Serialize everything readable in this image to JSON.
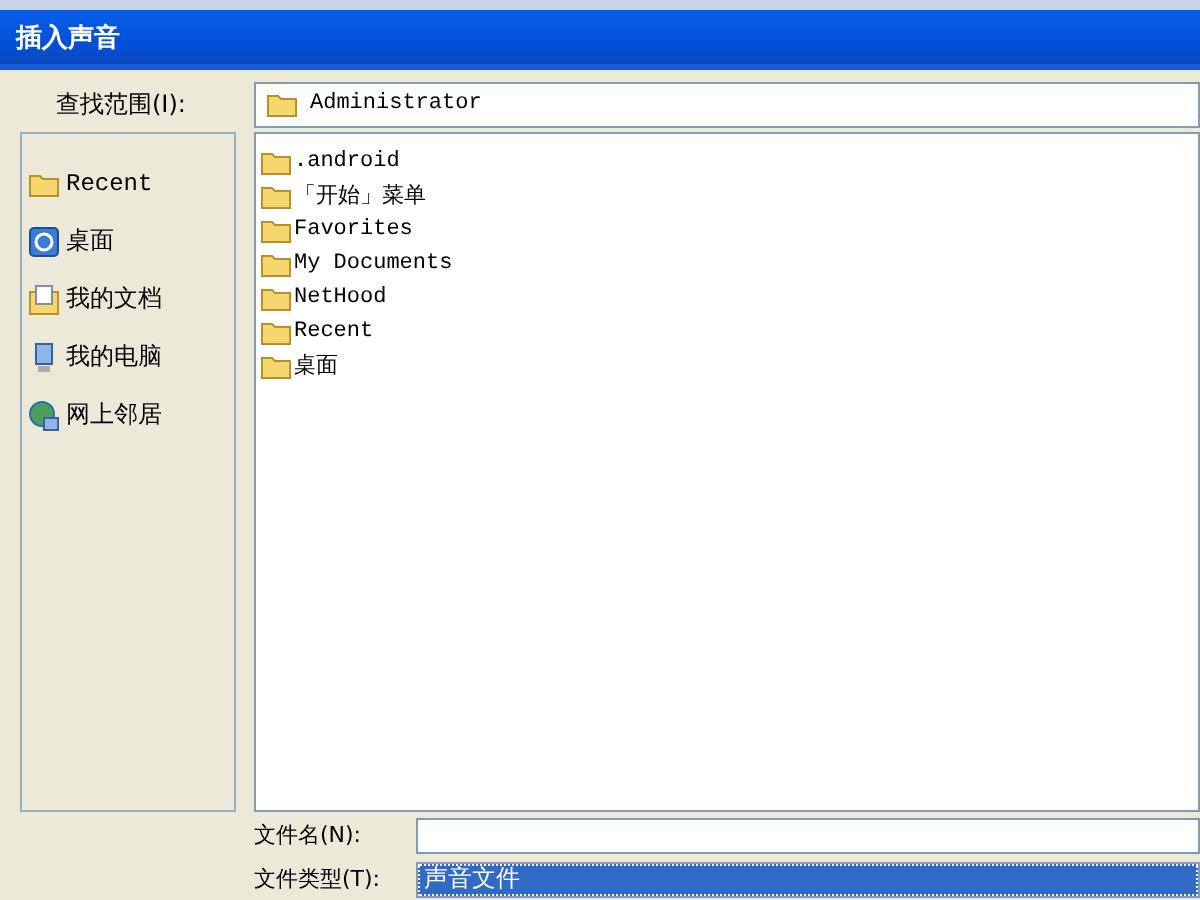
{
  "window": {
    "title": "插入声音"
  },
  "look_in": {
    "label": "查找范围(I):",
    "value": "Administrator"
  },
  "places": [
    {
      "label": "Recent",
      "kind": "folder"
    },
    {
      "label": "桌面",
      "kind": "desktop"
    },
    {
      "label": "我的文档",
      "kind": "documents"
    },
    {
      "label": "我的电脑",
      "kind": "computer"
    },
    {
      "label": "网上邻居",
      "kind": "network"
    }
  ],
  "files": [
    {
      "name": ".android"
    },
    {
      "name": "「开始」菜单"
    },
    {
      "name": "Favorites"
    },
    {
      "name": "My Documents"
    },
    {
      "name": "NetHood"
    },
    {
      "name": "Recent"
    },
    {
      "name": "桌面"
    }
  ],
  "file_name": {
    "label": "文件名(N):"
  },
  "file_type": {
    "label": "文件类型(T):",
    "value": "声音文件",
    "selected": true
  }
}
